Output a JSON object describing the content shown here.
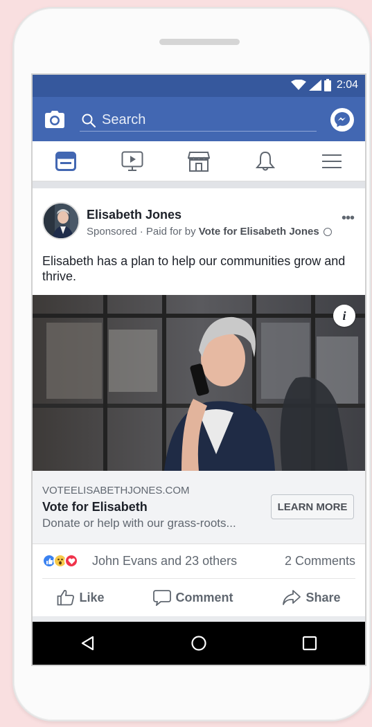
{
  "status_bar": {
    "time": "2:04"
  },
  "search": {
    "placeholder": "Search"
  },
  "nav_tabs": [
    {
      "icon": "news-feed-icon",
      "active": true
    },
    {
      "icon": "watch-video-icon",
      "active": false
    },
    {
      "icon": "marketplace-icon",
      "active": false
    },
    {
      "icon": "notifications-bell-icon",
      "active": false
    },
    {
      "icon": "menu-hamburger-icon",
      "active": false
    }
  ],
  "post": {
    "author": "Elisabeth Jones",
    "sponsored_label": "Sponsored",
    "paid_prefix": " · Paid for by ",
    "paid_by": "Vote for Elisabeth Jones",
    "more_label": "•••",
    "text": "Elisabeth has a plan to help our communities grow and thrive.",
    "info_label": "i",
    "link": {
      "domain": "VOTEELISABETHJONES.COM",
      "title": "Vote for Elisabeth",
      "description": "Donate or help with our grass-roots...",
      "cta": "LEARN MORE"
    },
    "reactions_text": "John Evans and 23 others",
    "comments_text": "2 Comments",
    "actions": {
      "like": "Like",
      "comment": "Comment",
      "share": "Share"
    }
  },
  "colors": {
    "brand_blue": "#4267b2",
    "status_blue": "#36589d",
    "background_pink": "#f9dfe0"
  }
}
